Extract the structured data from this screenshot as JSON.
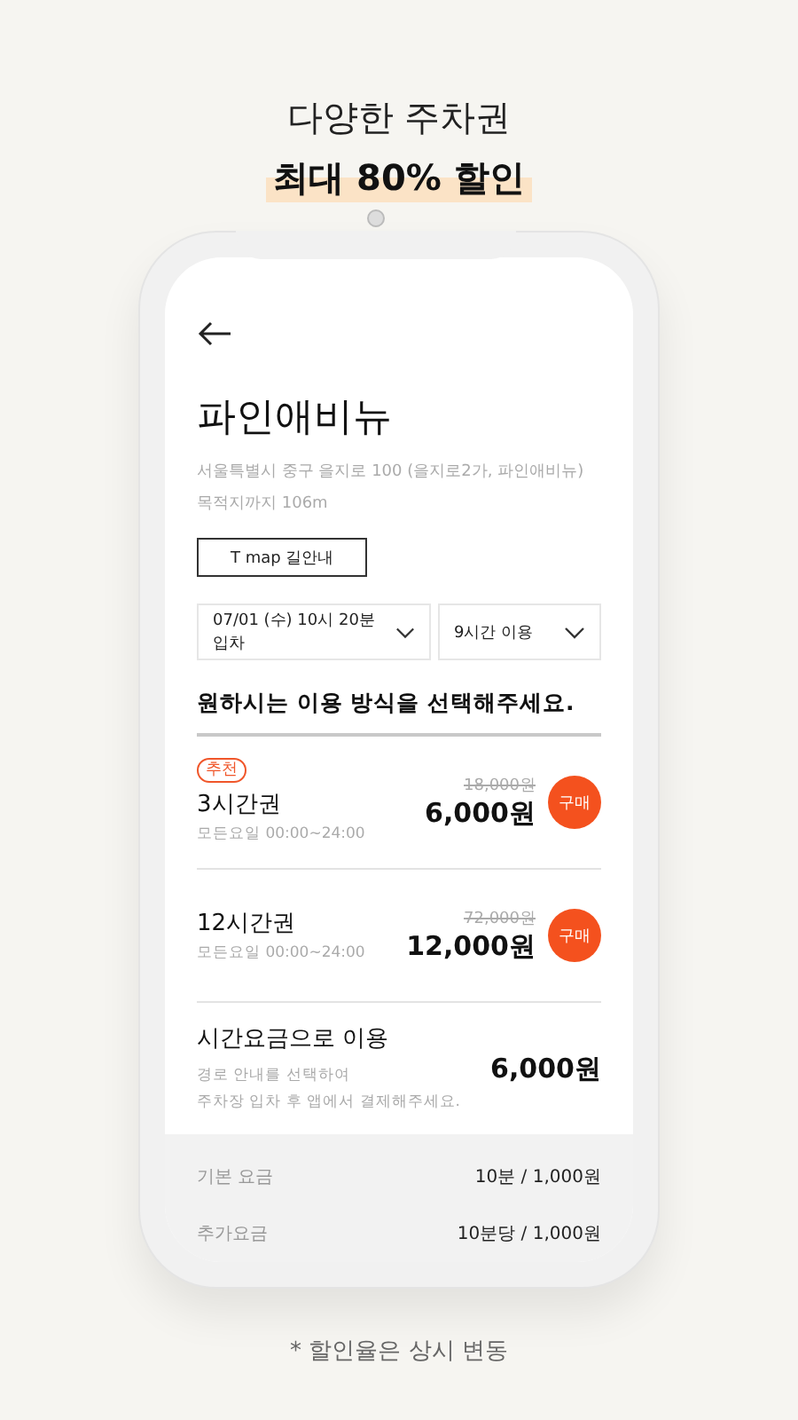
{
  "headline": {
    "line_1": "다양한 주차권",
    "line_2": "최대 80% 할인"
  },
  "screen": {
    "place": {
      "name": "파인애비뉴",
      "address": "서울특별시 중구 을지로 100 (을지로2가, 파인애비뉴)",
      "distance": "목적지까지 106m"
    },
    "nav_button": "T map 길안내",
    "selectors": [
      {
        "value": "07/01 (수) 10시 20분 입차"
      },
      {
        "value": "9시간 이용"
      }
    ],
    "prompt": "원하시는 이용 방식을 선택해주세요.",
    "options": [
      {
        "kind": "ticket",
        "badge": "추천",
        "name": "3시간권",
        "hours": "모든요일 00:00~24:00",
        "original_price": "18,000원",
        "price": "6,000원",
        "button": "구매"
      },
      {
        "kind": "ticket",
        "name": "12시간권",
        "hours": "모든요일 00:00~24:00",
        "original_price": "72,000원",
        "price": "12,000원",
        "button": "구매"
      },
      {
        "kind": "hourly",
        "name": "시간요금으로 이용",
        "note_lines": [
          "경로 안내를 선택하여",
          "주차장 입차 후 앱에서 결제해주세요."
        ],
        "price": "6,000원"
      }
    ],
    "fees": [
      {
        "label": "기본 요금",
        "value": "10분 / 1,000원"
      },
      {
        "label": "추가요금",
        "value": "10분당 / 1,000원"
      }
    ]
  },
  "footnote": "* 할인율은 상시 변동"
}
